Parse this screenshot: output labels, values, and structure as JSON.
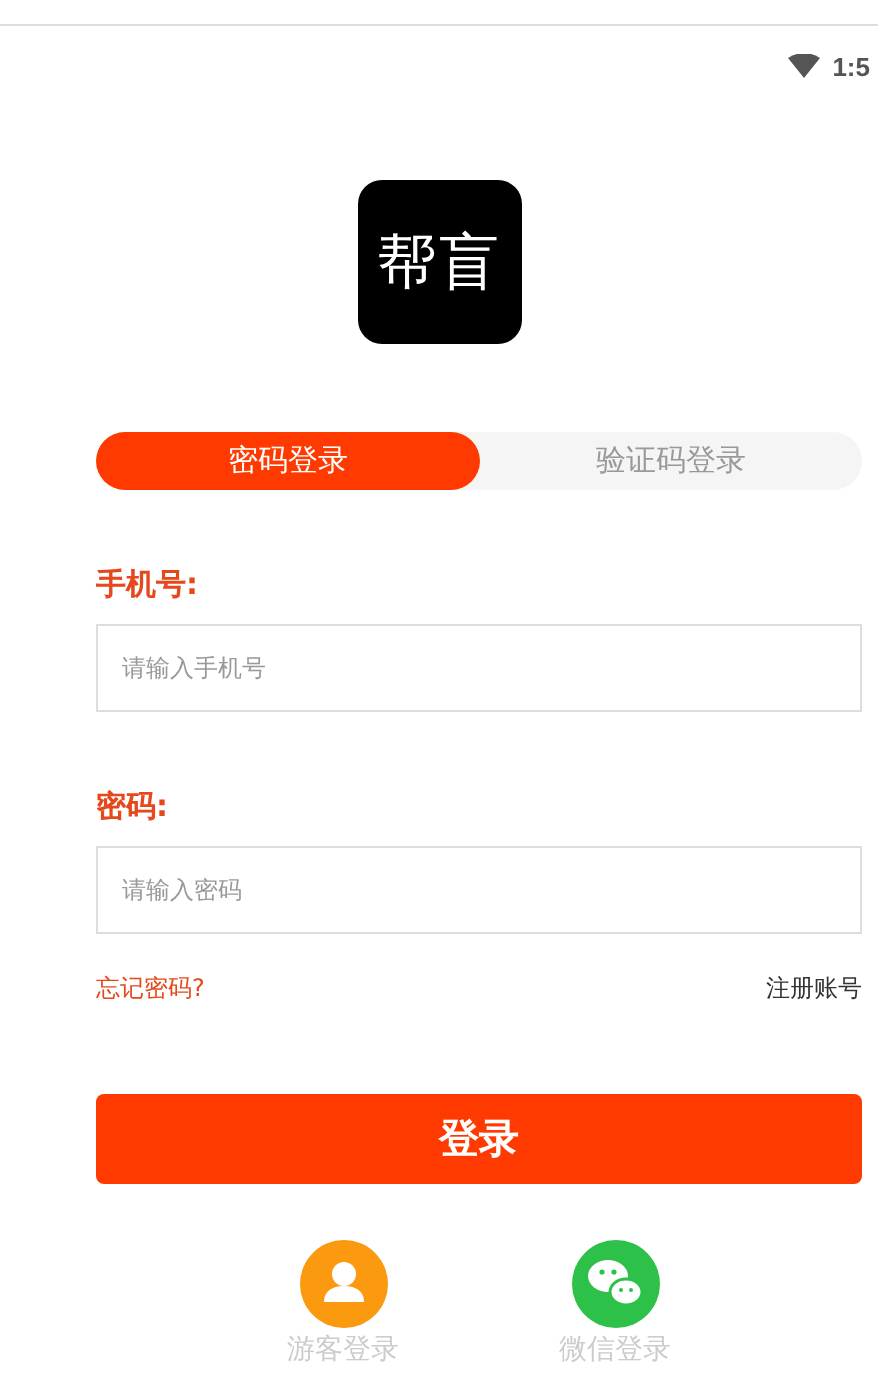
{
  "status_bar": {
    "time": "1:5"
  },
  "logo": {
    "text": "帮盲"
  },
  "tabs": [
    {
      "label": "密码登录",
      "selected": true
    },
    {
      "label": "验证码登录",
      "selected": false
    }
  ],
  "fields": [
    {
      "label": "手机号:",
      "placeholder": "请输入手机号"
    },
    {
      "label": "密码:",
      "placeholder": "请输入密码"
    }
  ],
  "links": {
    "forgot": "忘记密码?",
    "register": "注册账号"
  },
  "login_button": "登录",
  "alt_logins": [
    {
      "kind": "guest",
      "label": "游客登录"
    },
    {
      "kind": "wechat",
      "label": "微信登录"
    }
  ]
}
